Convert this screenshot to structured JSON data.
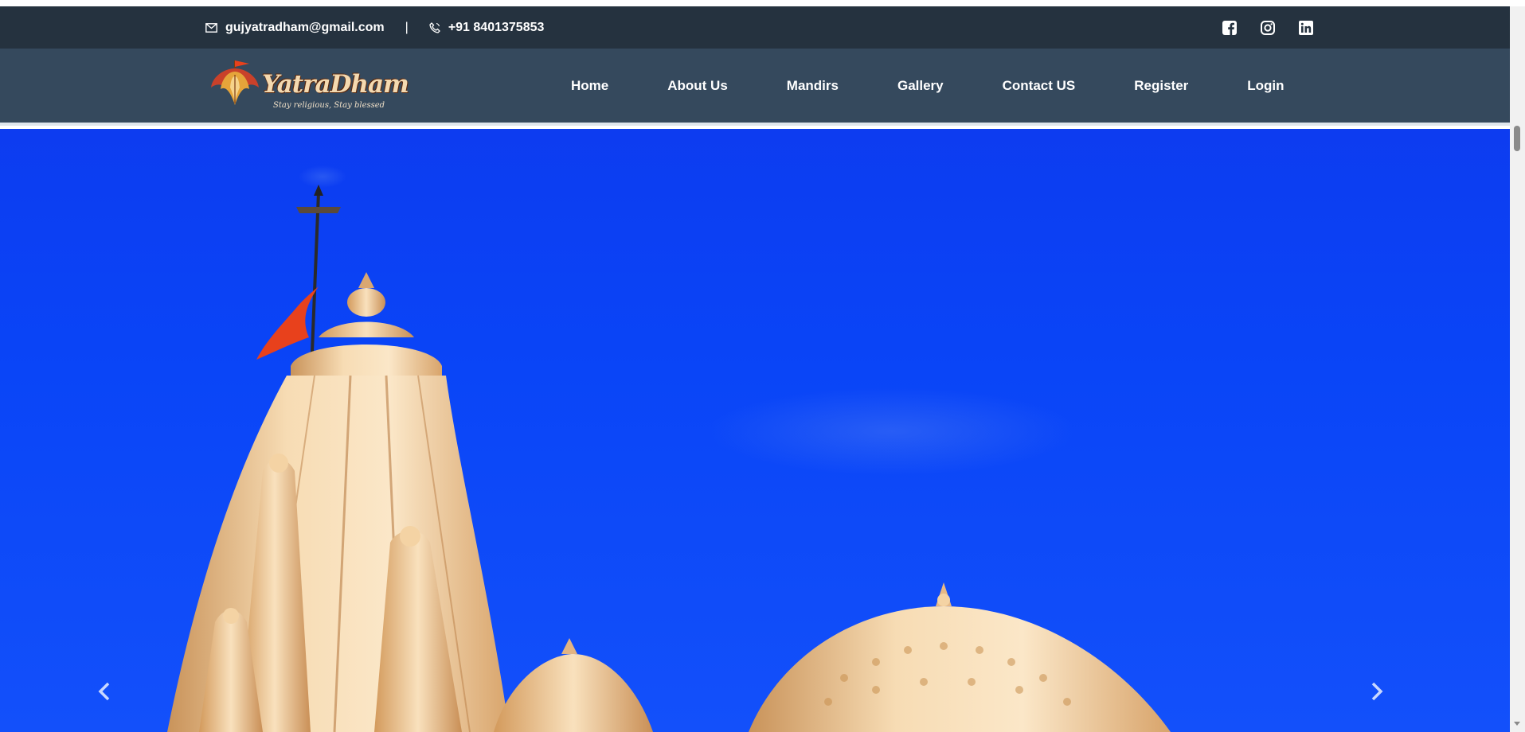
{
  "topbar": {
    "email": "gujyatradham@gmail.com",
    "separator": "|",
    "phone": "+91 8401375853",
    "icons": [
      "mail-icon",
      "phone-icon",
      "facebook-icon",
      "instagram-icon",
      "linkedin-icon"
    ]
  },
  "logo": {
    "name": "YatraDham",
    "tagline": "Stay religious, Stay blessed"
  },
  "nav": {
    "items": [
      "Home",
      "About Us",
      "Mandirs",
      "Gallery",
      "Contact US",
      "Register",
      "Login"
    ]
  },
  "hero": {
    "prev_icon": "chevron-left-icon",
    "next_icon": "chevron-right-icon"
  },
  "colors": {
    "topbar_bg": "#25323f",
    "navbar_bg": "#35495d",
    "sky": "#0a45f7",
    "flag": "#e8411c"
  }
}
